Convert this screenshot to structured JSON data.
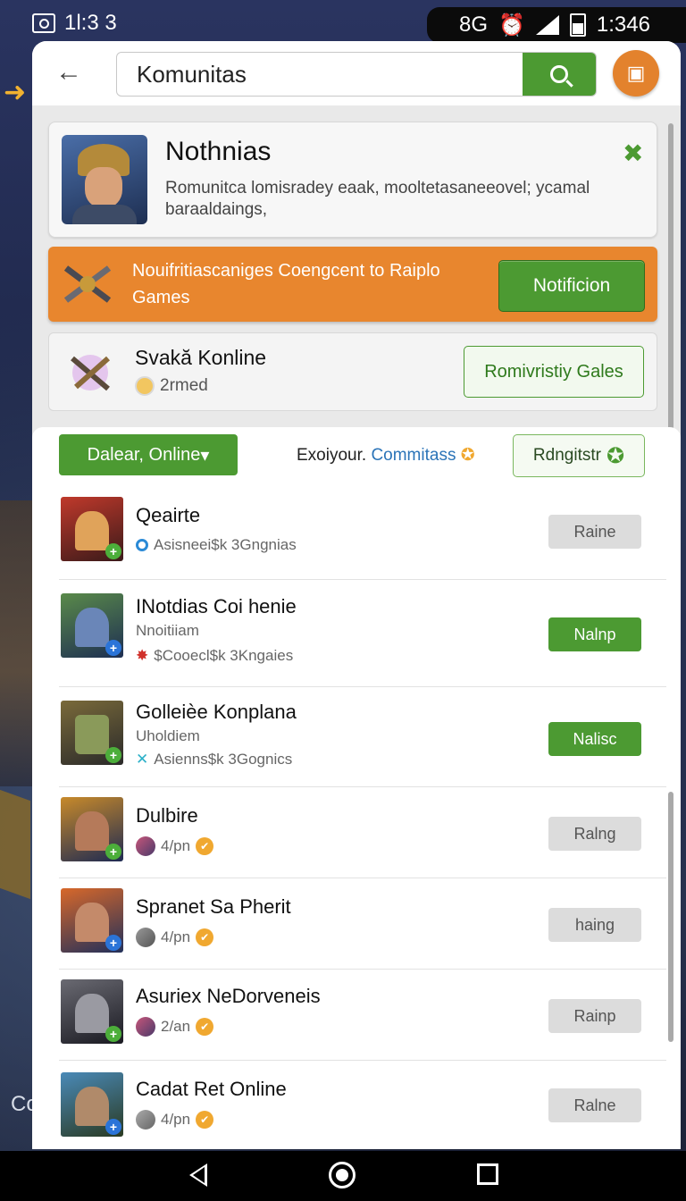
{
  "status_bar": {
    "time_left": "1l:3 3",
    "time_right": "1:346",
    "icons_text": "8G"
  },
  "header": {
    "search_value": "Komunitas",
    "search_placeholder": "Komunitas"
  },
  "profile_card": {
    "title": "Nothnias",
    "description": "Romunitca lomisradey eaak, mooltetasaneeovel; ycamal baraaldaings,"
  },
  "banner": {
    "text": "Nouifritiascaniges Coengcent to Raiplo Games",
    "button_label": "Notificion"
  },
  "online_card": {
    "title": "Svakă Konline",
    "meta": "2rmed",
    "button_label": "Romivristiy Gales"
  },
  "filters": {
    "dropdown_label": "Dalear, Online",
    "prompt_text": "Exoiyour.",
    "prompt_link": "Commitass",
    "register_label": "Rdngitstr"
  },
  "list": [
    {
      "name": "Qeairte",
      "sub": "",
      "meta": "Asisneei$k 3Gngnias",
      "button": "Raine",
      "button_style": "gray"
    },
    {
      "name": "INotdias Coi henie",
      "sub": "Nnoitiiam",
      "meta": "$Cooecl$k 3Kngaies",
      "button": "Nalnp",
      "button_style": "green"
    },
    {
      "name": "Golleièe Konplana",
      "sub": "Uholdiem",
      "meta": "Asienns$k 3Gognics",
      "button": "Nalisc",
      "button_style": "green"
    },
    {
      "name": "Dulbire",
      "sub": "",
      "meta": "4/pn",
      "button": "Ralng",
      "button_style": "gray"
    },
    {
      "name": "Spranet Sa Pherit",
      "sub": "",
      "meta": "4/pn",
      "button": "haing",
      "button_style": "gray"
    },
    {
      "name": "Asuriex NeDorveneis",
      "sub": "",
      "meta": "2/an",
      "button": "Rainp",
      "button_style": "gray"
    },
    {
      "name": "Cadat Ret Online",
      "sub": "",
      "meta": "4/pn",
      "button": "Ralne",
      "button_style": "gray"
    }
  ],
  "background": {
    "partial_text": "Co"
  },
  "colors": {
    "accent_green": "#4c9a32",
    "accent_orange": "#e8862e",
    "link_blue": "#2b74b8"
  }
}
